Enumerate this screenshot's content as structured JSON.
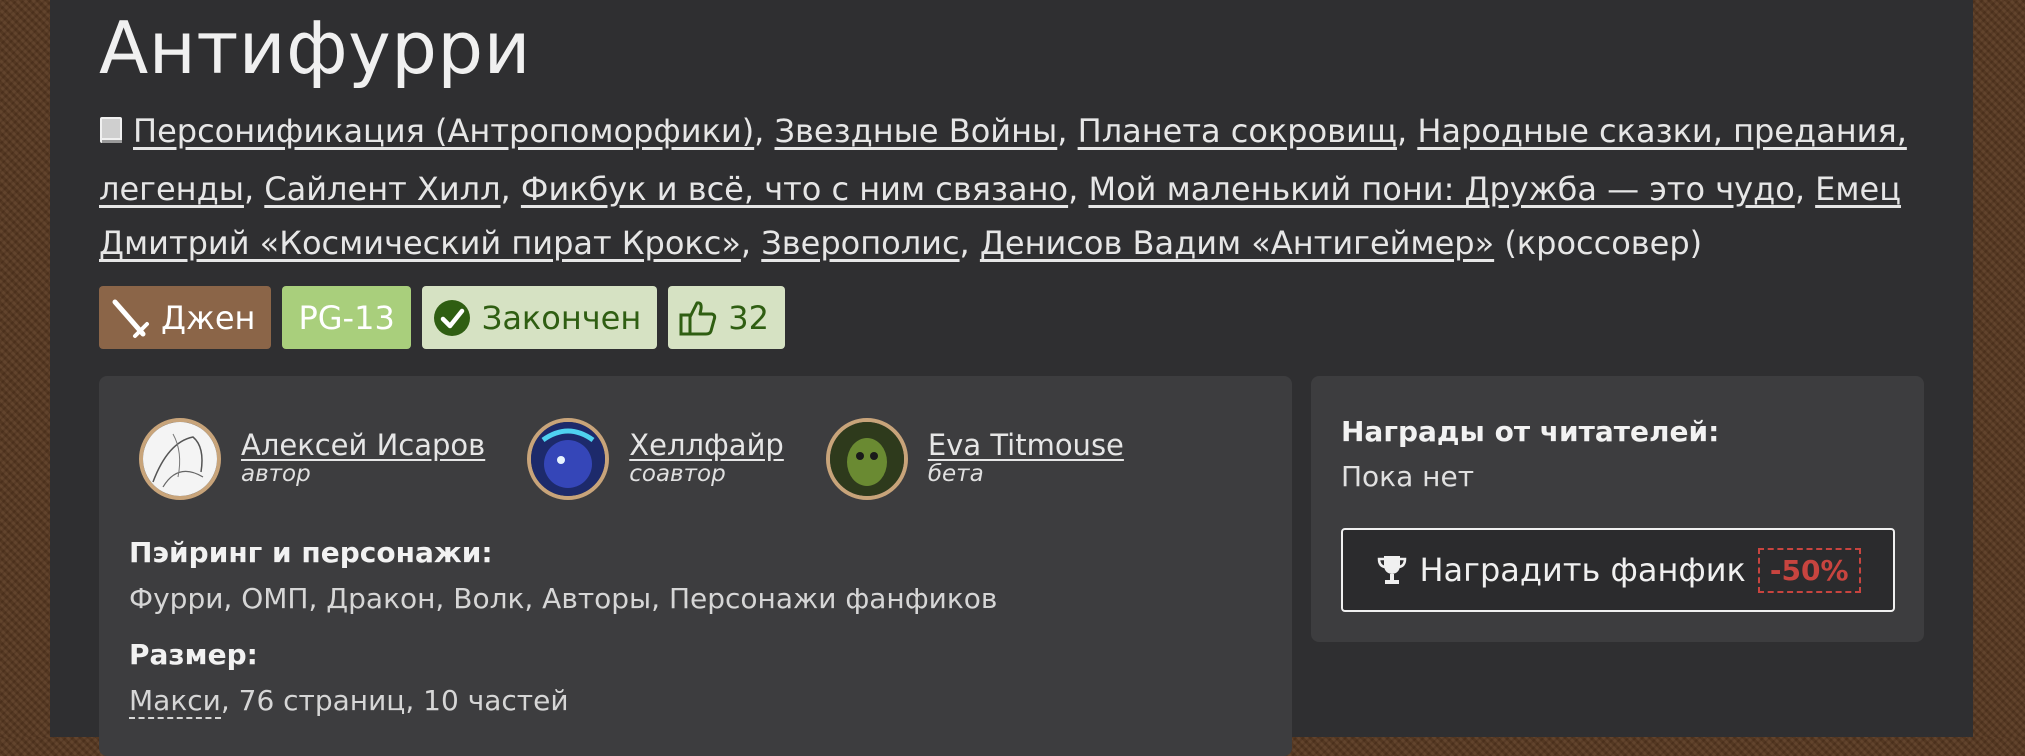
{
  "title": "Антифурри",
  "fandoms": [
    "Персонификация (Антропоморфики)",
    "Звездные Войны",
    "Планета сокровищ",
    "Народные сказки, предания, легенды",
    "Сайлент Хилл",
    "Фикбук и всё, что с ним связано",
    "Мой маленький пони: Дружба — это чудо",
    "Емец Дмитрий «Космический пират Крокс»",
    "Зверополис",
    "Денисов Вадим «Антигеймер»"
  ],
  "fandom_suffix": "(кроссовер)",
  "badges": {
    "direction": "Джен",
    "rating": "PG-13",
    "status": "Закончен",
    "likes": "32"
  },
  "people": [
    {
      "name": "Алексей Исаров",
      "role": "автор"
    },
    {
      "name": "Хеллфайр",
      "role": "соавтор"
    },
    {
      "name": "Eva Titmouse",
      "role": "бета"
    }
  ],
  "pairing": {
    "label": "Пэйринг и персонажи:",
    "value": "Фурри, ОМП, Дракон, Волк, Авторы, Персонажи фанфиков"
  },
  "size": {
    "label": "Размер:",
    "kind": "Макси",
    "rest": ", 76 страниц, 10 частей"
  },
  "awards": {
    "title": "Награды от читателей:",
    "empty": "Пока нет",
    "button": "Наградить фанфик",
    "discount": "-50%"
  },
  "colors": {
    "direction_badge": "#8b6548",
    "rating_badge": "#a9cf7c",
    "status_badge": "#d6e2c3",
    "discount": "#c8443f"
  }
}
